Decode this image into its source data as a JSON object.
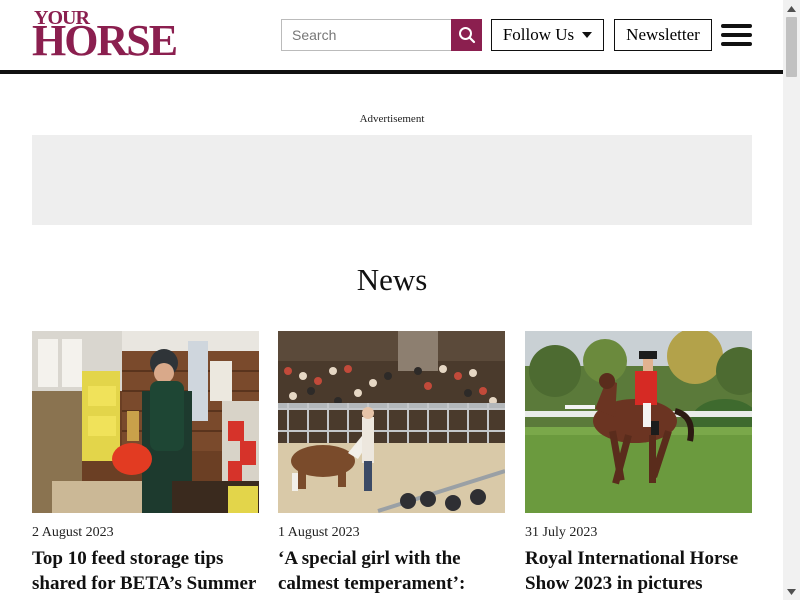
{
  "header": {
    "logo_top": "YOUR",
    "logo_main": "HORSE",
    "search_placeholder": "Search",
    "follow_label": "Follow Us",
    "newsletter_label": "Newsletter"
  },
  "ad": {
    "label": "Advertisement"
  },
  "section": {
    "title": "News"
  },
  "articles": [
    {
      "date": "2 August 2023",
      "title": "Top 10 feed storage tips shared for BETA’s Summer"
    },
    {
      "date": "1 August 2023",
      "title": "‘A special girl with the calmest temperament’:"
    },
    {
      "date": "31 July 2023",
      "title": "Royal International Horse Show 2023 in pictures"
    }
  ],
  "colors": {
    "brand": "#8b1f4f",
    "ad_bg": "#eeeeee",
    "rule": "#111111"
  },
  "icons": {
    "search": "search-icon",
    "menu": "hamburger-menu-icon",
    "follow": "caret-down-icon"
  }
}
